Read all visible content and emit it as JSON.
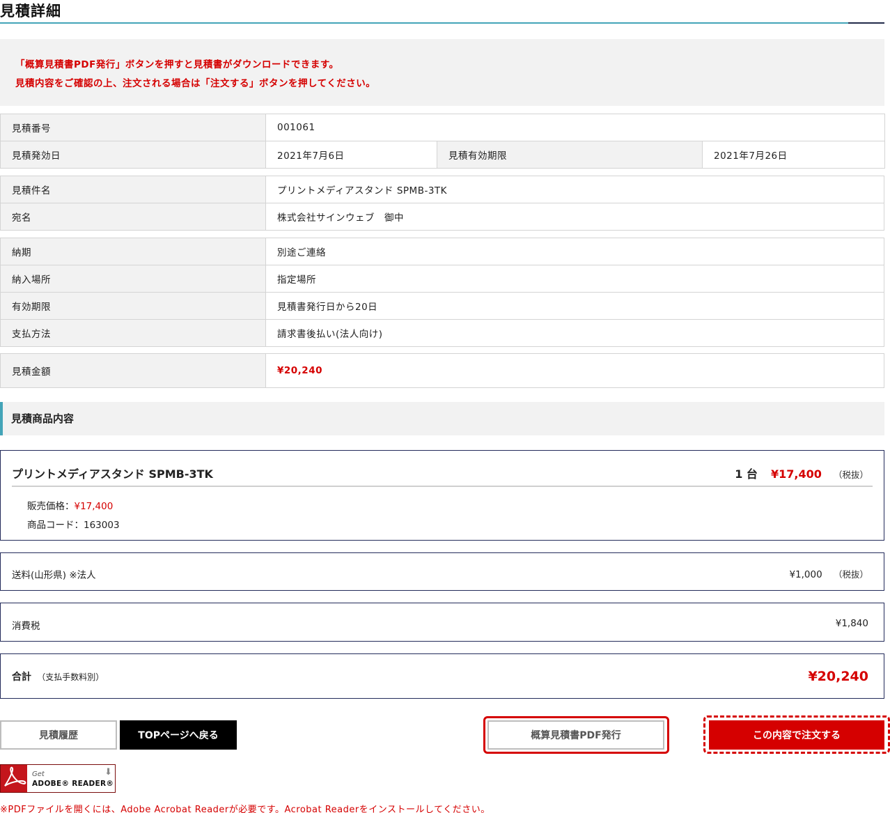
{
  "page": {
    "title": "見積詳細"
  },
  "notice": {
    "line1": "「概算見積書PDF発行」ボタンを押すと見積書がダウンロードできます。",
    "line2": "見積内容をご確認の上、注文される場合は「注文する」ボタンを押してください。"
  },
  "info": {
    "quote_no_label": "見積番号",
    "quote_no": "001061",
    "issue_date_label": "見積発効日",
    "issue_date": "2021年7月6日",
    "expiry_label": "見積有効期限",
    "expiry": "2021年7月26日",
    "subject_label": "見積件名",
    "subject": "プリントメディアスタンド SPMB-3TK",
    "recipient_label": "宛名",
    "recipient": "株式会社サインウェブ　御中",
    "delivery_label": "納期",
    "delivery": "別途ご連絡",
    "place_label": "納入場所",
    "place": "指定場所",
    "validity_label": "有効期限",
    "validity": "見積書発行日から20日",
    "payment_label": "支払方法",
    "payment": "請求書後払い(法人向け)",
    "amount_label": "見積金額",
    "amount": "¥20,240"
  },
  "section": {
    "title": "見積商品内容"
  },
  "product": {
    "name": "プリントメディアスタンド SPMB-3TK",
    "qty": "1 台",
    "price": "¥17,400",
    "tax": "（税抜）",
    "sale_price_label": "販売価格：",
    "sale_price": "¥17,400",
    "code_label": "商品コード：",
    "code": "163003"
  },
  "shipping": {
    "label": "送料(山形県) ※法人",
    "value": "¥1,000",
    "tax": "（税抜）"
  },
  "consumption_tax": {
    "label": "消費税",
    "value": "¥1,840"
  },
  "total": {
    "label": "合計",
    "note": "（支払手数料別）",
    "value": "¥20,240"
  },
  "buttons": {
    "history": "見積履歴",
    "top": "TOPページへ戻る",
    "pdf": "概算見積書PDF発行",
    "order": "この内容で注文する"
  },
  "adobe": {
    "get": "Get",
    "reader": "ADOBE® READER®"
  },
  "footnote": "※PDFファイルを開くには、Adobe Acrobat Readerが必要です。Acrobat Readerをインストールしてください。"
}
